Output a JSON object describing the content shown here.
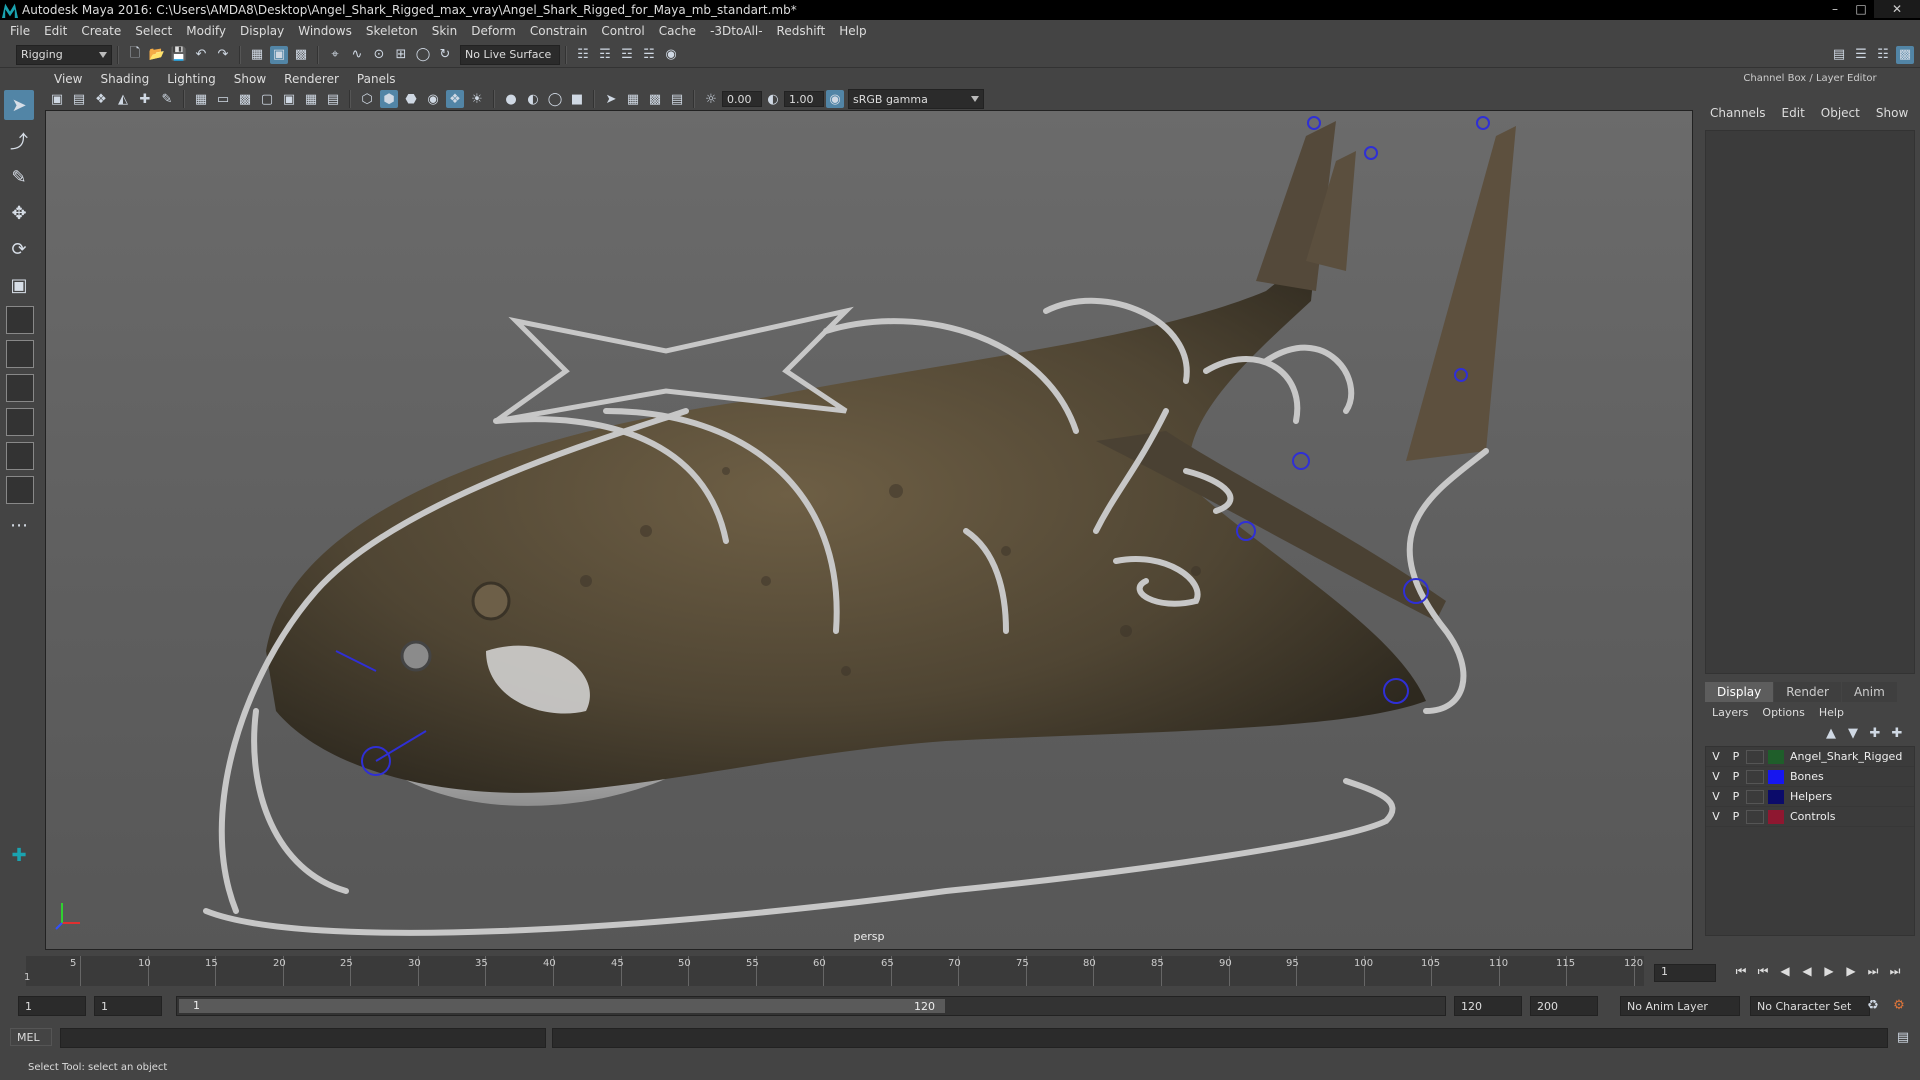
{
  "window": {
    "title": "Autodesk Maya 2016: C:\\Users\\AMDA8\\Desktop\\Angel_Shark_Rigged_max_vray\\Angel_Shark_Rigged_for_Maya_mb_standart.mb*",
    "minimize": "–",
    "maximize": "□",
    "close": "✕"
  },
  "menus": [
    "File",
    "Edit",
    "Create",
    "Select",
    "Modify",
    "Display",
    "Windows",
    "Skeleton",
    "Skin",
    "Deform",
    "Constrain",
    "Control",
    "Cache",
    "-3DtoAll-",
    "Redshift",
    "Help"
  ],
  "statusline": {
    "menu_set": "Rigging",
    "live_surface": "No Live Surface"
  },
  "panel_menus": [
    "View",
    "Shading",
    "Lighting",
    "Show",
    "Renderer",
    "Panels"
  ],
  "panel_toolbar": {
    "exposure": "0.00",
    "gamma": "1.00",
    "color_space": "sRGB gamma"
  },
  "viewport": {
    "camera": "persp"
  },
  "channel_box": {
    "title": "Channel Box / Layer Editor",
    "tabs": [
      "Channels",
      "Edit",
      "Object",
      "Show"
    ]
  },
  "layer_editor": {
    "tabs": [
      "Display",
      "Render",
      "Anim"
    ],
    "menus": [
      "Layers",
      "Options",
      "Help"
    ],
    "layers": [
      {
        "v": "V",
        "p": "P",
        "name": "Angel_Shark_Rigged",
        "color": "#1f5e2a"
      },
      {
        "v": "V",
        "p": "P",
        "name": "Bones",
        "color": "#1616f0"
      },
      {
        "v": "V",
        "p": "P",
        "name": "Helpers",
        "color": "#0b0b6a"
      },
      {
        "v": "V",
        "p": "P",
        "name": "Controls",
        "color": "#8e1730"
      }
    ]
  },
  "timeline": {
    "ticks": [
      "5",
      "10",
      "15",
      "20",
      "25",
      "30",
      "35",
      "40",
      "45",
      "50",
      "55",
      "60",
      "65",
      "70",
      "75",
      "80",
      "85",
      "90",
      "95",
      "100",
      "105",
      "110",
      "115",
      "120"
    ],
    "current_frame": "1",
    "start_label": "1"
  },
  "range": {
    "start": "1",
    "playback_start": "1",
    "slider_start": "1",
    "slider_end": "120",
    "playback_end": "120",
    "end": "200",
    "anim_layer": "No Anim Layer",
    "character_set": "No Character Set"
  },
  "cmdline": {
    "label": "MEL"
  },
  "helpline": {
    "text": "Select Tool: select an object"
  },
  "accent": "#5285a6"
}
